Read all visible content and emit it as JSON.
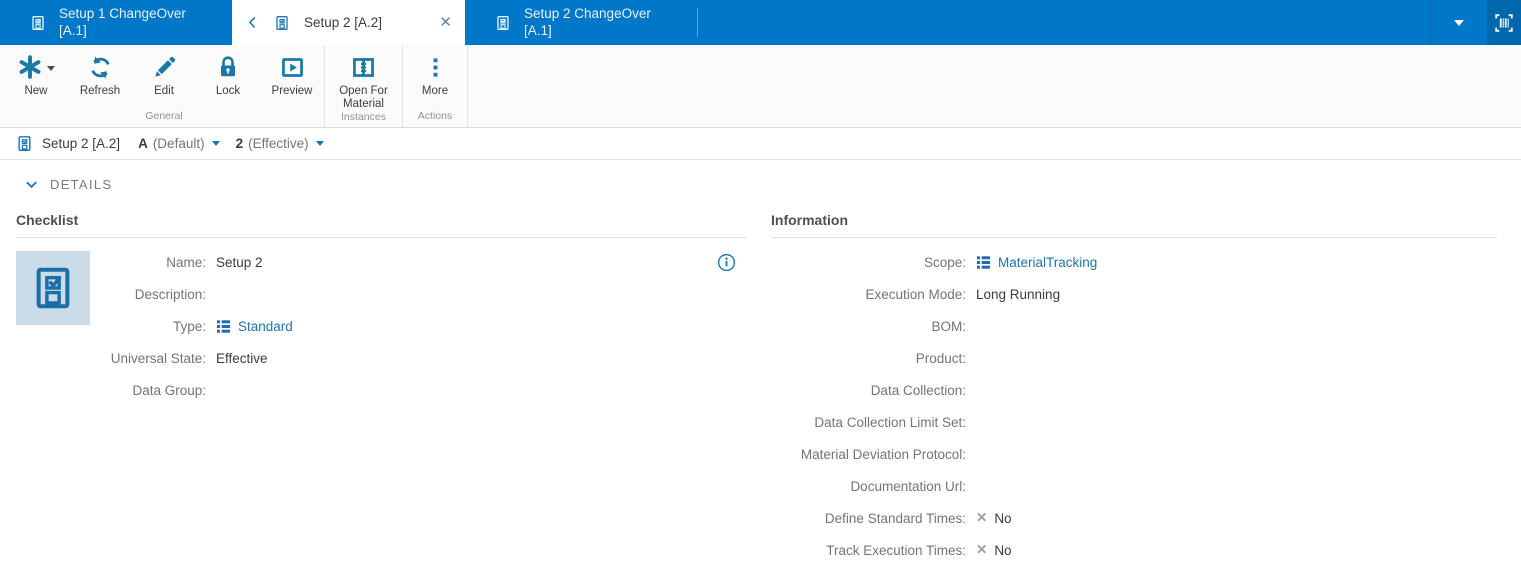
{
  "colors": {
    "header_blue": "#0077c8",
    "toolbar_icon_teal": "#1878a6",
    "link_blue": "#1d76b5",
    "list_icon_blue": "#2268b2",
    "avatar_bg": "#cbdce9",
    "text_dark": "#3b3b42",
    "label_gray": "#73737d",
    "no_mark_gray": "#9b9ba3"
  },
  "glyphs": {
    "close": "✕",
    "no": "✕"
  },
  "tabbar": {
    "tabs": [
      {
        "line1": "Setup 1 ChangeOver",
        "line2": "[A.1]"
      },
      {
        "title": "Setup 2 [A.2]"
      },
      {
        "line1": "Setup 2 ChangeOver",
        "line2": "[A.1]"
      }
    ]
  },
  "toolbar": {
    "groups": [
      {
        "label": "General",
        "buttons": [
          {
            "label": "New"
          },
          {
            "label": "Refresh"
          },
          {
            "label": "Edit"
          },
          {
            "label": "Lock"
          },
          {
            "label": "Preview"
          }
        ]
      },
      {
        "label": "Instances",
        "buttons": [
          {
            "label": "Open For Material"
          }
        ]
      },
      {
        "label": "Actions",
        "buttons": [
          {
            "label": "More"
          }
        ]
      }
    ]
  },
  "breadcrumb": {
    "title": "Setup 2 [A.2]",
    "version": "A",
    "version_state": "(Default)",
    "revision": "2",
    "revision_state": "(Effective)"
  },
  "details": {
    "header": "DETAILS"
  },
  "checklist": {
    "section_title": "Checklist",
    "fields": [
      {
        "label": "Name:",
        "value": "Setup 2"
      },
      {
        "label": "Description:",
        "value": ""
      },
      {
        "label": "Type:",
        "value": "Standard"
      },
      {
        "label": "Universal State:",
        "value": "Effective"
      },
      {
        "label": "Data Group:",
        "value": ""
      }
    ]
  },
  "information": {
    "section_title": "Information",
    "fields": [
      {
        "label": "Scope:",
        "value": "MaterialTracking"
      },
      {
        "label": "Execution Mode:",
        "value": "Long Running"
      },
      {
        "label": "BOM:",
        "value": ""
      },
      {
        "label": "Product:",
        "value": ""
      },
      {
        "label": "Data Collection:",
        "value": ""
      },
      {
        "label": "Data Collection Limit Set:",
        "value": ""
      },
      {
        "label": "Material Deviation Protocol:",
        "value": ""
      },
      {
        "label": "Documentation Url:",
        "value": ""
      },
      {
        "label": "Define Standard Times:",
        "value": "No"
      },
      {
        "label": "Track Execution Times:",
        "value": "No"
      }
    ]
  }
}
